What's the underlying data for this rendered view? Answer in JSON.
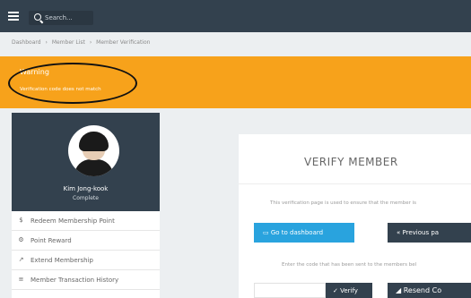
{
  "search": {
    "placeholder": "Search..."
  },
  "breadcrumb": [
    "Dashboard",
    "Member List",
    "Member Verification"
  ],
  "warning": {
    "title": "Warning",
    "text": "Verification code does not match"
  },
  "profile": {
    "name": "Kim Jong-kook",
    "status": "Complete"
  },
  "menu": {
    "items": [
      {
        "icon": "$",
        "label": "Redeem Membership Point"
      },
      {
        "icon": "⚙",
        "label": "Point Reward"
      },
      {
        "icon": "↗",
        "label": "Extend Membership"
      },
      {
        "icon": "≡",
        "label": "Member Transaction History"
      }
    ]
  },
  "verify": {
    "title": "VERIFY MEMBER",
    "description": "This verification page is used to ensure that the member is",
    "dashboard_label": "Go to dashboard",
    "previous_label": "Previous pa",
    "enter_text": "Enter the code that has been sent to the members bel",
    "verify_label": "✓ Verify",
    "resend_label": "Resend Co"
  },
  "colors": {
    "topbar": "#33414e",
    "warning": "#f7a21b",
    "primary": "#29a3de",
    "dark": "#33414e"
  }
}
